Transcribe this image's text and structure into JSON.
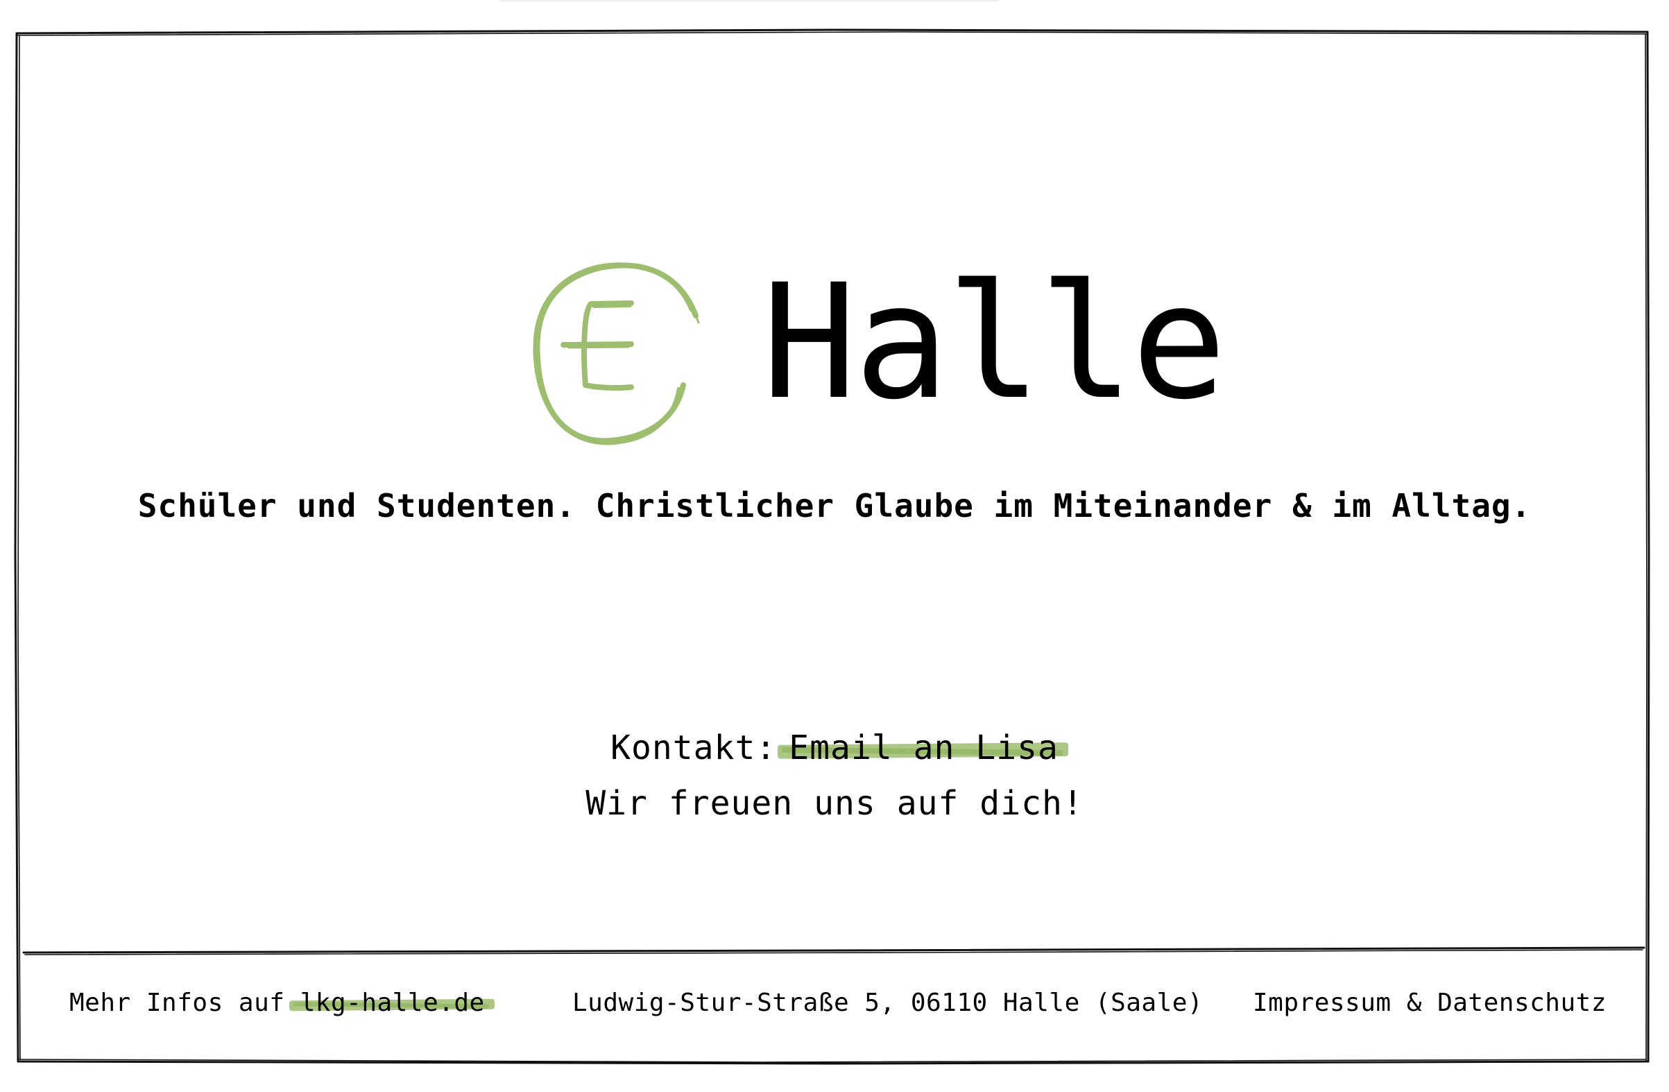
{
  "hero": {
    "title": "Halle",
    "logo_icon": "ec-logo-icon",
    "logo_color": "#9dbd6f",
    "tagline": "Schüler und Studenten. Christlicher Glaube im Miteinander & im Alltag."
  },
  "contact": {
    "label": "Kontakt:",
    "link_label": "Email an Lisa",
    "greeting": "Wir freuen uns auf dich!"
  },
  "footer": {
    "info_prefix": "Mehr Infos auf",
    "info_link": "lkg-halle.de",
    "address": "Ludwig-Stur-Straße 5, 06110 Halle (Saale)",
    "legal_link": "Impressum & Datenschutz"
  },
  "colors": {
    "highlight": "#a3c176",
    "text": "#000000",
    "background": "#ffffff"
  }
}
